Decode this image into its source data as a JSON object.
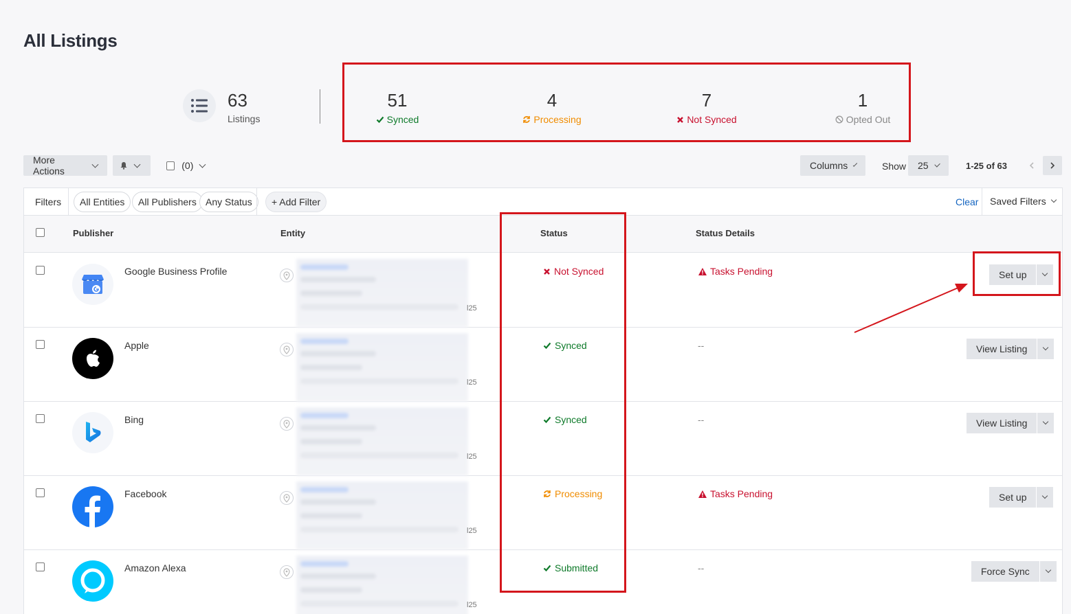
{
  "page": {
    "title": "All Listings"
  },
  "summary": {
    "total": "63",
    "total_label": "Listings",
    "stats": [
      {
        "value": "51",
        "label": "Synced",
        "icon": "check-icon",
        "color": "#0e7a2a"
      },
      {
        "value": "4",
        "label": "Processing",
        "icon": "refresh-icon",
        "color": "#f08c00"
      },
      {
        "value": "7",
        "label": "Not Synced",
        "icon": "x-icon",
        "color": "#c8102e"
      },
      {
        "value": "1",
        "label": "Opted Out",
        "icon": "ban-icon",
        "color": "#888888"
      }
    ]
  },
  "toolbar": {
    "more_actions": "More Actions",
    "selected_count": "(0)",
    "columns": "Columns",
    "show_label": "Show",
    "page_size": "25",
    "range": "1-25 of 63"
  },
  "filters": {
    "label": "Filters",
    "chips": [
      "All Entities",
      "All Publishers",
      "Any Status"
    ],
    "add_filter": "+ Add Filter",
    "clear": "Clear",
    "saved_filters": "Saved Filters"
  },
  "table": {
    "columns": {
      "publisher": "Publisher",
      "entity": "Entity",
      "status": "Status",
      "status_details": "Status Details"
    },
    "rows": [
      {
        "publisher": "Google Business Profile",
        "logo": "google-business-profile-logo",
        "entity_tail": "l25",
        "status": "Not Synced",
        "status_kind": "not-synced",
        "details": "Tasks Pending",
        "action": "Set up"
      },
      {
        "publisher": "Apple",
        "logo": "apple-logo",
        "entity_tail": "l25",
        "status": "Synced",
        "status_kind": "synced",
        "details": "--",
        "action": "View Listing"
      },
      {
        "publisher": "Bing",
        "logo": "bing-logo",
        "entity_tail": "l25",
        "status": "Synced",
        "status_kind": "synced",
        "details": "--",
        "action": "View Listing"
      },
      {
        "publisher": "Facebook",
        "logo": "facebook-logo",
        "entity_tail": "l25",
        "status": "Processing",
        "status_kind": "processing",
        "details": "Tasks Pending",
        "action": "Set up"
      },
      {
        "publisher": "Amazon Alexa",
        "logo": "amazon-alexa-logo",
        "entity_tail": "l25",
        "status": "Submitted",
        "status_kind": "synced",
        "details": "--",
        "action": "Force Sync"
      }
    ]
  },
  "colors": {
    "highlight": "#d4161c",
    "synced": "#0e7a2a",
    "processing": "#f08c00",
    "error": "#c8102e",
    "link": "#1565c0"
  }
}
